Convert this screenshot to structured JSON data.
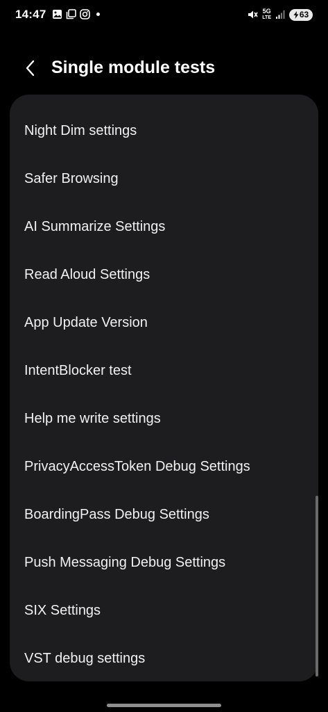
{
  "status_bar": {
    "time": "14:47",
    "network_top": "5G",
    "network_bottom": "LTE",
    "battery_level": "63"
  },
  "header": {
    "title": "Single module tests"
  },
  "list": {
    "items": [
      {
        "label": "Night Dim settings"
      },
      {
        "label": "Safer Browsing"
      },
      {
        "label": "AI Summarize Settings"
      },
      {
        "label": "Read Aloud Settings"
      },
      {
        "label": "App Update Version"
      },
      {
        "label": "IntentBlocker test"
      },
      {
        "label": "Help me write settings"
      },
      {
        "label": "PrivacyAccessToken Debug Settings"
      },
      {
        "label": "BoardingPass Debug Settings"
      },
      {
        "label": "Push Messaging Debug Settings"
      },
      {
        "label": "SIX Settings"
      },
      {
        "label": "VST debug settings"
      }
    ]
  },
  "icons": {
    "gallery": "image-icon",
    "multiwindow": "multi-window-icon",
    "instagram": "instagram-icon",
    "mute": "mute-icon",
    "signal": "signal-bars-icon",
    "battery": "battery-icon",
    "back": "back-chevron-icon"
  },
  "colors": {
    "background": "#000000",
    "card": "#1d1d1f",
    "text": "#f1f1f1"
  }
}
